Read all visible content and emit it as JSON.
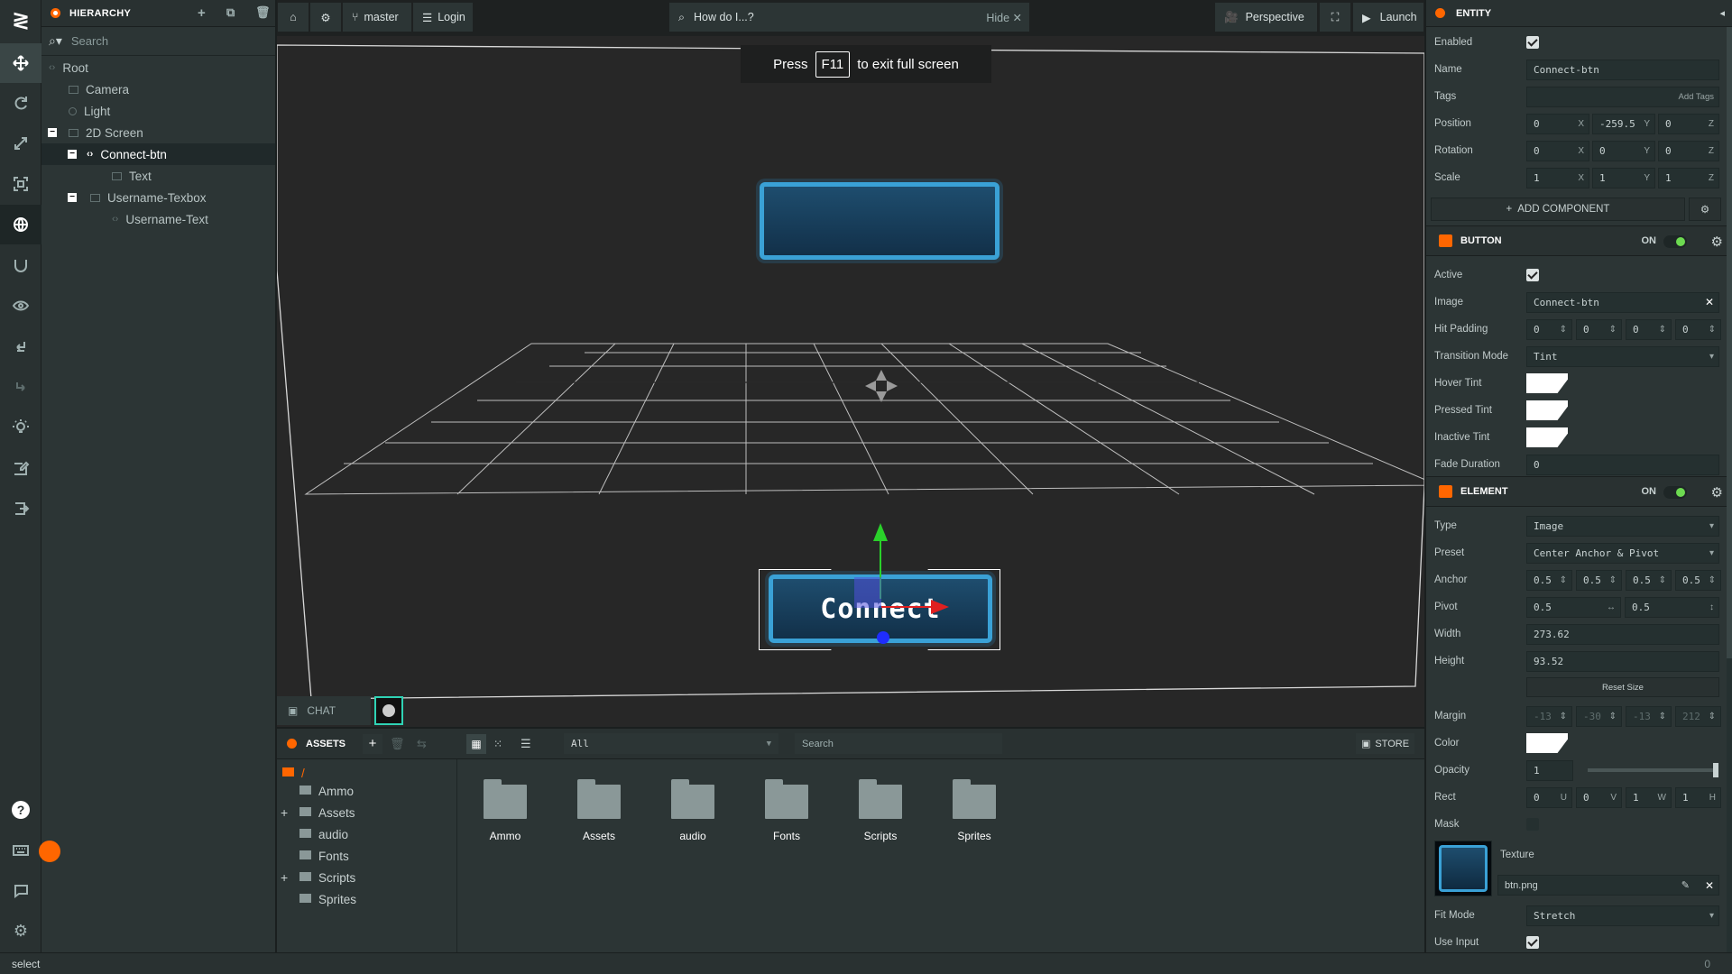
{
  "hierarchy": {
    "title": "HIERARCHY",
    "search_placeholder": "Search",
    "items": [
      {
        "label": "Root"
      },
      {
        "label": "Camera"
      },
      {
        "label": "Light"
      },
      {
        "label": "2D Screen"
      },
      {
        "label": "Connect-btn"
      },
      {
        "label": "Text"
      },
      {
        "label": "Username-Texbox"
      },
      {
        "label": "Username-Text"
      }
    ]
  },
  "topbar": {
    "branch": "master",
    "login": "Login",
    "search_placeholder": "How do I...?",
    "hide": "Hide",
    "perspective": "Perspective",
    "launch": "Launch"
  },
  "viewport": {
    "f11_press": "Press",
    "f11_key": "F11",
    "f11_rest": "to exit full screen",
    "button_text": "Connect"
  },
  "chat": {
    "label": "CHAT"
  },
  "assets": {
    "title": "ASSETS",
    "filter": "All",
    "search_placeholder": "Search",
    "store": "STORE",
    "root": "/",
    "folders": [
      "Ammo",
      "Assets",
      "audio",
      "Fonts",
      "Scripts",
      "Sprites"
    ]
  },
  "entity": {
    "title": "ENTITY",
    "enabled_label": "Enabled",
    "name_label": "Name",
    "name": "Connect-btn",
    "tags_label": "Tags",
    "add_tags": "Add Tags",
    "position_label": "Position",
    "position": [
      "0",
      "-259.5",
      "0"
    ],
    "rotation_label": "Rotation",
    "rotation": [
      "0",
      "0",
      "0"
    ],
    "scale_label": "Scale",
    "scale": [
      "1",
      "1",
      "1"
    ],
    "add_component": "ADD COMPONENT"
  },
  "axis": {
    "x": "X",
    "y": "Y",
    "z": "Z"
  },
  "button_comp": {
    "title": "BUTTON",
    "on": "ON",
    "active_label": "Active",
    "image_label": "Image",
    "image": "Connect-btn",
    "hit_padding_label": "Hit Padding",
    "hit_padding": [
      "0",
      "0",
      "0",
      "0"
    ],
    "transition_label": "Transition Mode",
    "transition": "Tint",
    "hover_label": "Hover Tint",
    "pressed_label": "Pressed Tint",
    "inactive_label": "Inactive Tint",
    "fade_label": "Fade Duration",
    "fade": "0"
  },
  "element_comp": {
    "title": "ELEMENT",
    "on": "ON",
    "type_label": "Type",
    "type": "Image",
    "preset_label": "Preset",
    "preset": "Center Anchor & Pivot",
    "anchor_label": "Anchor",
    "anchor": [
      "0.5",
      "0.5",
      "0.5",
      "0.5"
    ],
    "pivot_label": "Pivot",
    "pivot": [
      "0.5",
      "0.5"
    ],
    "width_label": "Width",
    "width": "273.62",
    "height_label": "Height",
    "height": "93.52",
    "reset_size": "Reset Size",
    "margin_label": "Margin",
    "margin": [
      "-13",
      "-30",
      "-13",
      "212"
    ],
    "color_label": "Color",
    "opacity_label": "Opacity",
    "opacity": "1",
    "rect_label": "Rect",
    "rect": [
      "0",
      "0",
      "1",
      "1"
    ],
    "rect_axes": [
      "U",
      "V",
      "W",
      "H"
    ],
    "mask_label": "Mask",
    "texture_label": "Texture",
    "texture": "btn.png",
    "fit_label": "Fit Mode",
    "fit": "Stretch",
    "use_input_label": "Use Input"
  },
  "status": {
    "text": "select",
    "right": "0"
  },
  "colors": {
    "accent": "#ff6600",
    "toggle_on": "#6dda51",
    "panel": "#2c3535",
    "viewport": "#272727"
  }
}
